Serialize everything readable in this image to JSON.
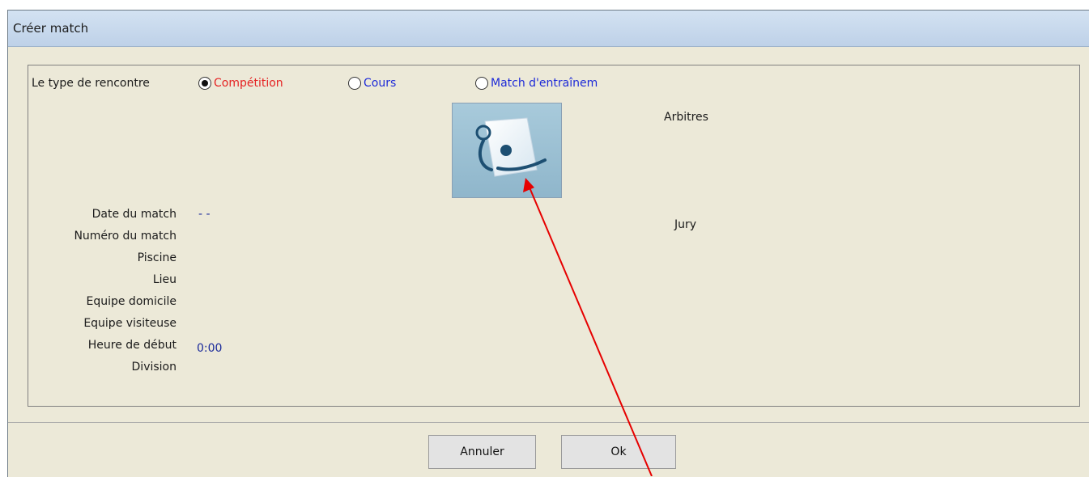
{
  "window": {
    "title": "Créer match"
  },
  "match_type": {
    "label": "Le type de rencontre",
    "options": [
      {
        "label": "Compétition",
        "selected": true,
        "color": "#e52222"
      },
      {
        "label": "Cours",
        "selected": false,
        "color": "#1d2ad8"
      },
      {
        "label": "Match d'entraînem",
        "selected": false,
        "color": "#1d2ad8"
      }
    ]
  },
  "sections": {
    "arbitres": "Arbitres",
    "jury": "Jury"
  },
  "fields": [
    {
      "label": "Date du match",
      "value": "- -"
    },
    {
      "label": "Numéro du match",
      "value": ""
    },
    {
      "label": "Piscine",
      "value": ""
    },
    {
      "label": "Lieu",
      "value": ""
    },
    {
      "label": "Equipe domicile",
      "value": ""
    },
    {
      "label": "Equipe visiteuse",
      "value": ""
    },
    {
      "label": "Heure de début",
      "value": "0:00"
    },
    {
      "label": "Division",
      "value": ""
    }
  ],
  "buttons": {
    "cancel": "Annuler",
    "ok": "Ok"
  },
  "icons": {
    "image_button": "water-polo-logo-icon"
  },
  "colors": {
    "annotation_arrow": "#e60000",
    "value_text": "#1a2a9a"
  }
}
